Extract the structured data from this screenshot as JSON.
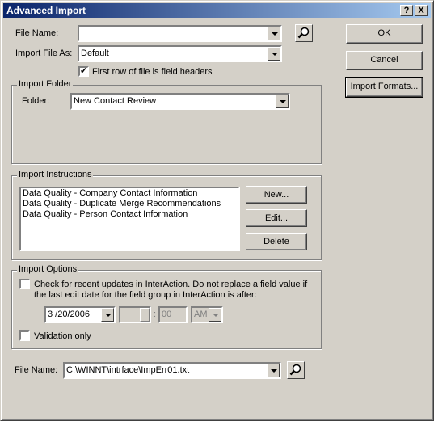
{
  "window": {
    "title": "Advanced Import",
    "help": "?",
    "close": "X"
  },
  "file_name": {
    "label": "File Name:",
    "value": ""
  },
  "import_as": {
    "label": "Import File As:",
    "value": "Default"
  },
  "first_row": {
    "label": "First row of file is field headers",
    "checked": true
  },
  "folder_group": {
    "label": "Import Folder",
    "folder_label": "Folder:",
    "folder_value": "New Contact Review"
  },
  "instructions": {
    "label": "Import Instructions",
    "items": [
      "Data Quality - Company Contact Information",
      "Data Quality - Duplicate Merge Recommendations",
      "Data Quality - Person Contact Information"
    ],
    "new": "New...",
    "edit": "Edit...",
    "delete": "Delete"
  },
  "options": {
    "label": "Import Options",
    "check_line1": "Check for recent updates in InterAction. Do not replace a field value if",
    "check_line2": "the last edit date for the field group in InterAction is after:",
    "date": "3 /20/2006",
    "time_sep": ":",
    "minutes": "00",
    "ampm": "AM",
    "validation": "Validation only"
  },
  "error_file": {
    "label": "File Name:",
    "value": "C:\\WINNT\\intrface\\ImpErr01.txt"
  },
  "buttons": {
    "ok": "OK",
    "cancel": "Cancel",
    "formats": "Import Formats..."
  },
  "icons": {
    "search": "magnifier-icon",
    "dropdown": "chevron-down-icon"
  }
}
